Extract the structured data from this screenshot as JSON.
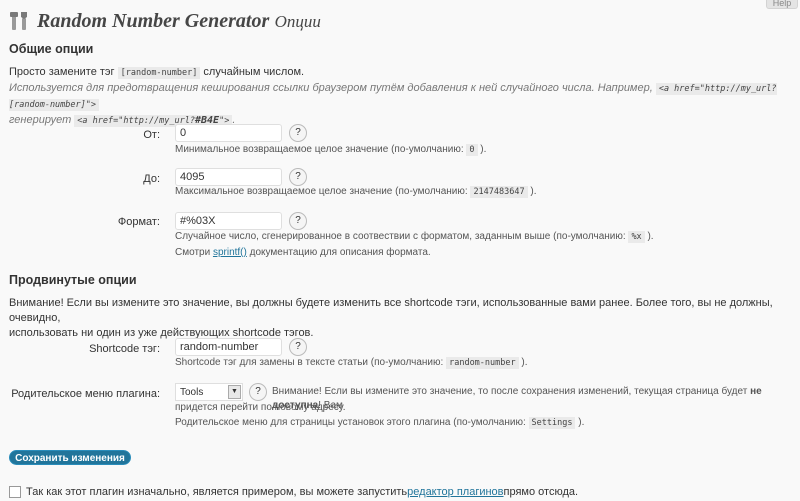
{
  "help_tab": "Help",
  "header": {
    "title": "Random Number Generator",
    "subtitle": "Опции",
    "icon": "tools-icon"
  },
  "general": {
    "heading": "Общие опции",
    "intro_1a": "Просто замените тэг ",
    "intro_1_code": "[random-number]",
    "intro_1b": " случайным числом.",
    "intro_2": "Используется для предотвращения кеширования ссылки браузером путём добавления к ней случайного числа. Например, ",
    "intro_2_code": "<a href=\"http://my_url?[random-number]\">",
    "intro_3a": "генерирует ",
    "intro_3_code": "<a href=\"http://my_url?",
    "intro_3_code_bold": "#B4E",
    "intro_3_code_end": "\">",
    "intro_3b": "."
  },
  "fields": {
    "from": {
      "label": "От:",
      "value": "0",
      "help": "?",
      "desc_a": "Минимальное возвращаемое целое значение (по-умолчанию: ",
      "desc_code": "0",
      "desc_b": " )."
    },
    "to": {
      "label": "До:",
      "value": "4095",
      "help": "?",
      "desc_a": "Максимальное возвращаемое целое значение (по-умолчанию: ",
      "desc_code": "2147483647",
      "desc_b": " )."
    },
    "format": {
      "label": "Формат:",
      "value": "#%03X",
      "help": "?",
      "desc_a": "Случайное число, сгенерированное в соотвествии с форматом, заданным выше (по-умолчанию: ",
      "desc_code": "%x",
      "desc_b": " ).",
      "desc2_a": "Смотри ",
      "desc2_link": "sprintf()",
      "desc2_b": " документацию для описания формата."
    }
  },
  "advanced": {
    "heading": "Продвинутые опции",
    "warning_1": "Внимание! Если вы измените это значение, вы должны будете изменить все shortcode тэги, использованные вами ранее. Более того, вы не должны, очевидно,",
    "warning_2": "использовать ни один из уже действующих shortcode тэгов.",
    "shortcode": {
      "label": "Shortcode тэг:",
      "value": "random-number",
      "help": "?",
      "desc_a": "Shortcode тэг для замены в тексте статьи (по-умолчанию: ",
      "desc_code": "random-number",
      "desc_b": " )."
    },
    "parent": {
      "label": "Родительское меню плагина:",
      "selected": "Tools",
      "help": "?",
      "warn_a": "Внимание! Если вы измените это значение, то после сохранения изменений, текущая страница будет ",
      "warn_bold": "не доступна",
      "warn_b": "! Вам",
      "warn_2": "придется перейти по новому адресу.",
      "desc_a": "Родительское меню для страницы установок этого плагина (по-умолчанию: ",
      "desc_code": "Settings",
      "desc_b": " )."
    }
  },
  "save_label": "Сохранить изменения",
  "footer": {
    "text_a": "Так как этот плагин изначально, является примером, вы можете запустить ",
    "link": "редактор плагинов",
    "text_b": " прямо отсюда."
  }
}
